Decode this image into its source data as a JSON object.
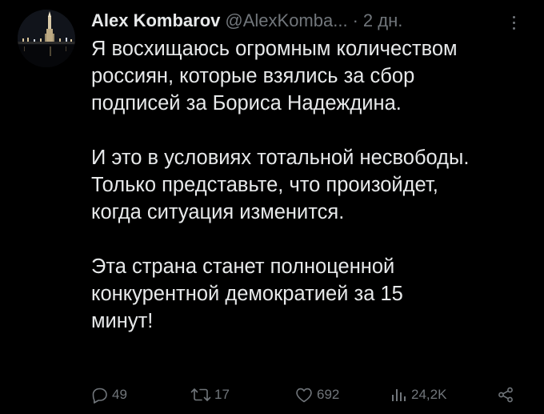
{
  "author": {
    "name": "Alex Kombarov",
    "handle": "@AlexKomba...",
    "separator": "·",
    "time": "2 дн."
  },
  "paragraphs": [
    {
      "lines": [
        "Я восхищаюсь огромным количеством",
        "россиян, которые взялись за сбор",
        "подписей за Бориса Надеждина."
      ]
    },
    {
      "lines": [
        "И это в условиях тотальной несвободы.",
        "Только представьте, что произойдет,",
        "когда ситуация изменится."
      ]
    },
    {
      "lines": [
        "Эта страна станет полноценной",
        "конкурентной демократией за 15",
        "минут!"
      ]
    }
  ],
  "actions": {
    "reply": {
      "icon": "reply-icon",
      "count": "49"
    },
    "repost": {
      "icon": "repost-icon",
      "count": "17"
    },
    "like": {
      "icon": "heart-icon",
      "count": "692"
    },
    "views": {
      "icon": "views-icon",
      "count": "24,2K"
    },
    "share": {
      "icon": "share-icon"
    }
  },
  "colors": {
    "background": "#000000",
    "text": "#e7e9ea",
    "muted": "#71767b"
  }
}
